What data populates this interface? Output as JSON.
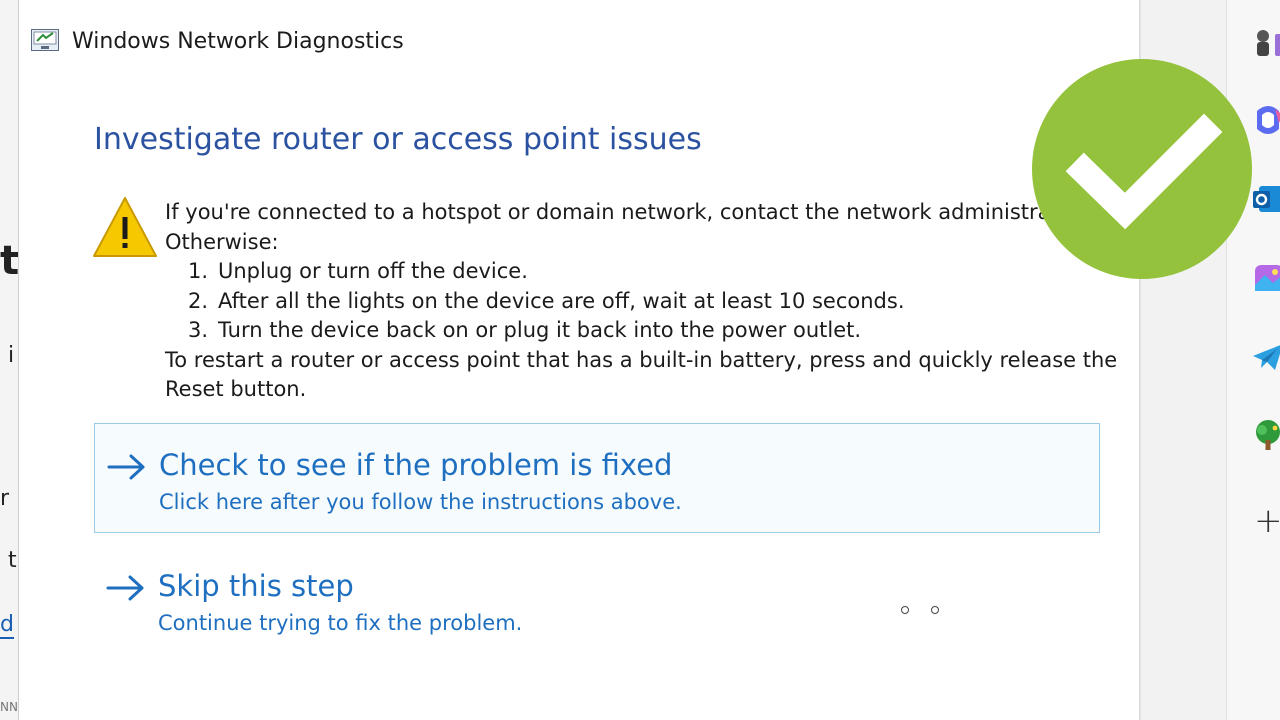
{
  "window": {
    "title": "Windows Network Diagnostics"
  },
  "content": {
    "heading": "Investigate router or access point issues",
    "line1": "If you're connected to a hotspot or domain network, contact the network administrat",
    "line2": "Otherwise:",
    "steps": [
      {
        "num": "1.",
        "text": "Unplug or turn off the device."
      },
      {
        "num": "2.",
        "text": "After all the lights on the device are off, wait at least 10 seconds."
      },
      {
        "num": "3.",
        "text": "Turn the device back on or plug it back into the power outlet."
      }
    ],
    "line3": "To restart a router or access point that has a built-in battery, press and quickly release the",
    "line4": "Reset button."
  },
  "options": {
    "check": {
      "title": "Check to see if the problem is fixed",
      "subtitle": "Click here after you follow the instructions above."
    },
    "skip": {
      "title": "Skip this step",
      "subtitle": "Continue trying to fix the problem."
    }
  },
  "background_window": {
    "fragments": [
      "t",
      "i",
      "r",
      "t",
      "d",
      "NN"
    ]
  },
  "icons": {
    "app": "network-diagnostics-icon",
    "warning": "warning-triangle-icon",
    "arrow": "right-arrow-icon",
    "badge": "green-checkmark-icon",
    "sidebar": [
      "chess-icon",
      "copilot-icon",
      "outlook-icon",
      "designer-icon",
      "telegram-icon",
      "tree-icon",
      "add-icon"
    ]
  },
  "colors": {
    "heading": "#2a52a0",
    "link": "#1f6fc0",
    "selected_border": "#9ccbe8",
    "badge": "#94c23c",
    "warning": "#f6c800"
  }
}
